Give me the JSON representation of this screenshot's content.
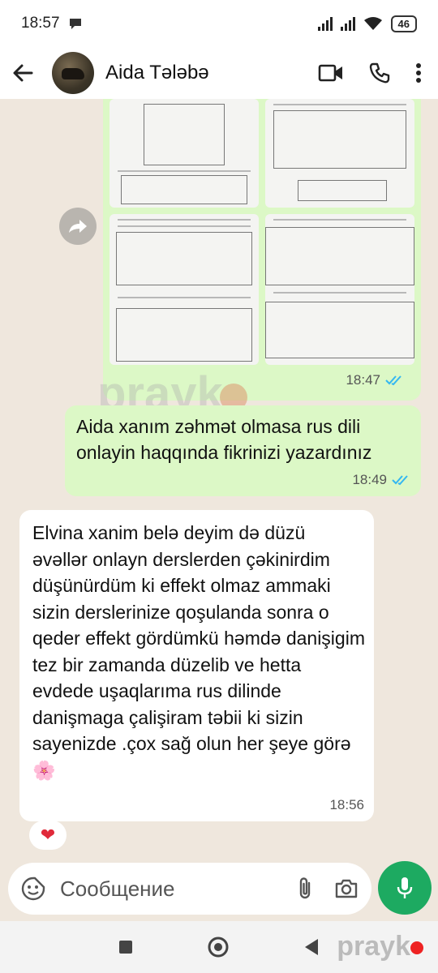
{
  "status_bar": {
    "time": "18:57",
    "battery": "46"
  },
  "header": {
    "contact_name": "Aida Tələbə"
  },
  "messages": {
    "media": {
      "time": "18:47",
      "status": "read"
    },
    "outgoing": {
      "text": "Aida xanım zəhmət olmasa rus dili onlayin haqqında fikrinizi yazardınız",
      "time": "18:49",
      "status": "read"
    },
    "incoming": {
      "text": "Elvina xanim  belə deyim də düzü əvəllər onlayn derslerden çəkinirdim düşünürdüm ki effekt olmaz ammaki sizin derslerinize qoşulanda sonra o qeder effekt gördümkü həmdə danişigim  tez bir zamanda düzelib ve hetta evdede uşaqlarıma rus dilinde danişmaga çalişiram təbii ki sizin sayenizde .çox sağ olun her şeye görə 🌸",
      "time": "18:56",
      "reaction": "❤"
    }
  },
  "composer": {
    "placeholder": "Сообщение"
  },
  "watermark": {
    "brand": "prayk"
  },
  "icons": [
    "back-arrow-icon",
    "video-call-icon",
    "phone-icon",
    "more-vert-icon",
    "forward-icon",
    "sticker-icon",
    "attach-icon",
    "camera-icon",
    "mic-icon",
    "double-check-icon",
    "nav-square-icon",
    "nav-home-icon",
    "nav-back-icon"
  ],
  "colors": {
    "outgoing_bubble": "#dcf8c6",
    "incoming_bubble": "#ffffff",
    "chat_bg": "#efe7dd",
    "mic_green": "#1daa61",
    "read_tick": "#34b7f1"
  }
}
